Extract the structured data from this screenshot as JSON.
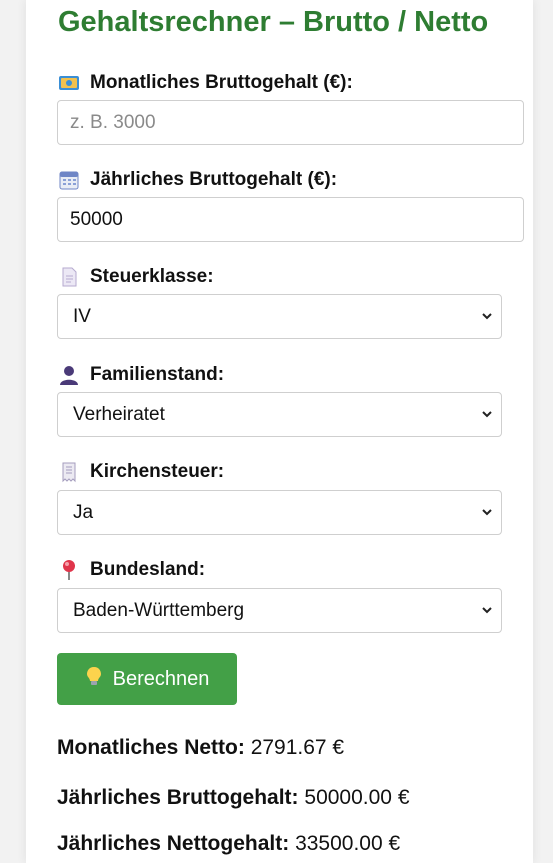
{
  "title": "Gehaltsrechner – Brutto / Netto",
  "fields": {
    "monthly": {
      "label": "Monatliches Bruttogehalt (€):",
      "placeholder": "z. B. 3000",
      "value": ""
    },
    "yearly": {
      "label": "Jährliches Bruttogehalt (€):",
      "value": "50000"
    },
    "taxclass": {
      "label": "Steuerklasse:",
      "value": "IV"
    },
    "marital": {
      "label": "Familienstand:",
      "value": "Verheiratet"
    },
    "church": {
      "label": "Kirchensteuer:",
      "value": "Ja"
    },
    "state": {
      "label": "Bundesland:",
      "value": "Baden-Württemberg"
    }
  },
  "icons": {
    "monthly": "money-icon",
    "yearly": "calendar-icon",
    "taxclass": "document-icon",
    "marital": "person-icon",
    "church": "receipt-icon",
    "state": "pin-icon",
    "button": "lightbulb-icon"
  },
  "button_label": "Berechnen",
  "results": {
    "monthly_net_label": "Monatliches Netto:",
    "monthly_net_value": "2791.67 €",
    "yearly_gross_label": "Jährliches Bruttogehalt:",
    "yearly_gross_value": "50000.00 €",
    "yearly_net_label": "Jährliches Nettogehalt:",
    "yearly_net_value": "33500.00 €"
  },
  "colors": {
    "title": "#2e7d32",
    "button": "#43a047"
  }
}
